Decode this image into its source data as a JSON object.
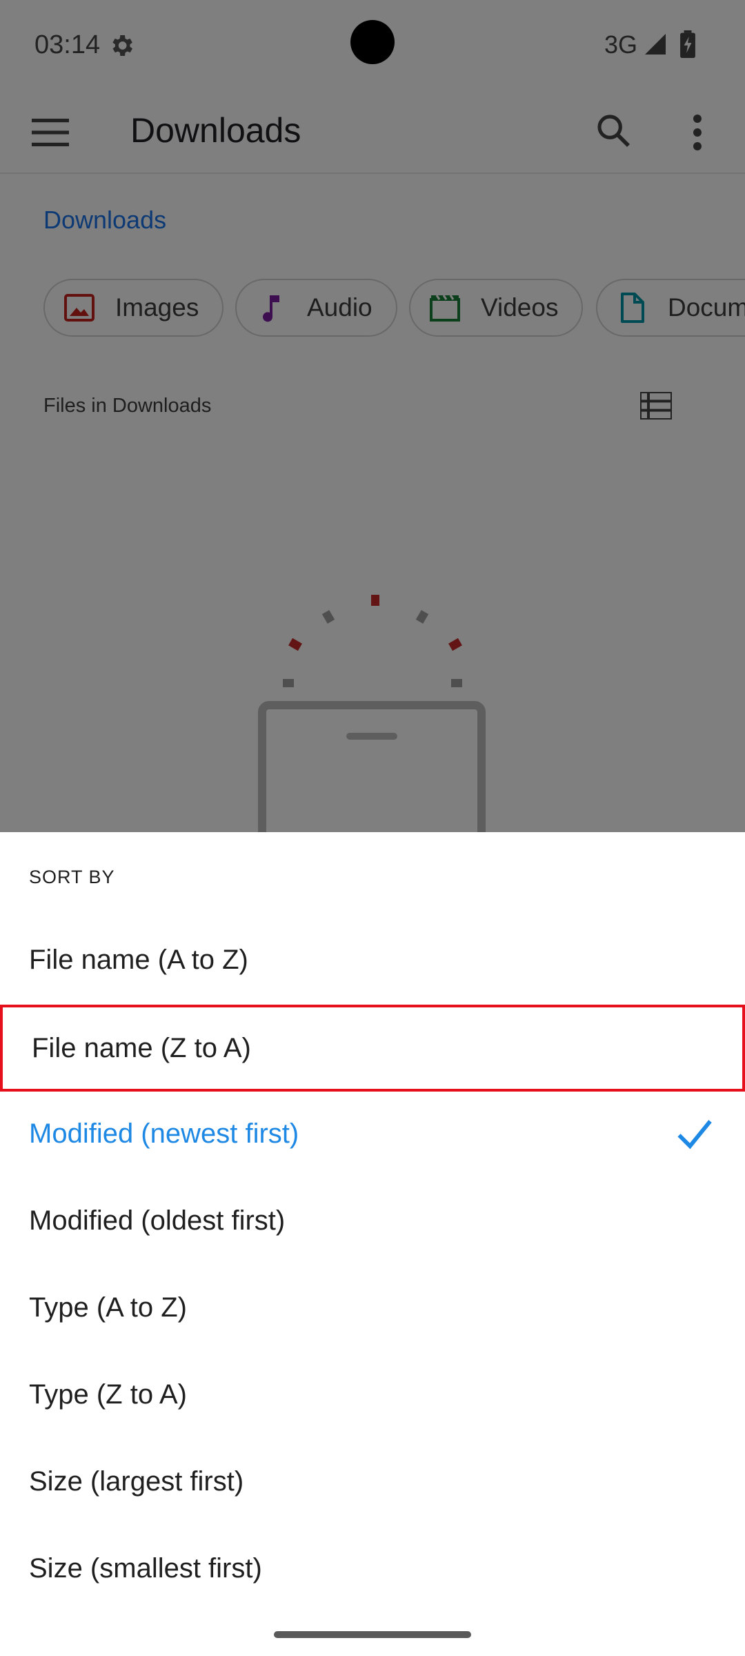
{
  "status_bar": {
    "time": "03:14",
    "network": "3G"
  },
  "app_bar": {
    "title": "Downloads"
  },
  "breadcrumb": "Downloads",
  "chips": [
    {
      "label": "Images",
      "icon": "image-icon",
      "color": "#c5221f"
    },
    {
      "label": "Audio",
      "icon": "music-note-icon",
      "color": "#7b1fa2"
    },
    {
      "label": "Videos",
      "icon": "movie-icon",
      "color": "#188038"
    },
    {
      "label": "Documents",
      "icon": "document-icon",
      "color": "#0097a7"
    }
  ],
  "files_header": "Files in Downloads",
  "sort_sheet": {
    "title": "SORT BY",
    "options": [
      {
        "label": "File name (A to Z)",
        "selected": false
      },
      {
        "label": "File name (Z to A)",
        "selected": false,
        "highlighted": true
      },
      {
        "label": "Modified (newest first)",
        "selected": true
      },
      {
        "label": "Modified (oldest first)",
        "selected": false
      },
      {
        "label": "Type (A to Z)",
        "selected": false
      },
      {
        "label": "Type (Z to A)",
        "selected": false
      },
      {
        "label": "Size (largest first)",
        "selected": false
      },
      {
        "label": "Size (smallest first)",
        "selected": false
      }
    ]
  },
  "colors": {
    "accent": "#1e88e5",
    "highlight_border": "#e5101b",
    "scrim": "rgba(0,0,0,0.5)"
  }
}
